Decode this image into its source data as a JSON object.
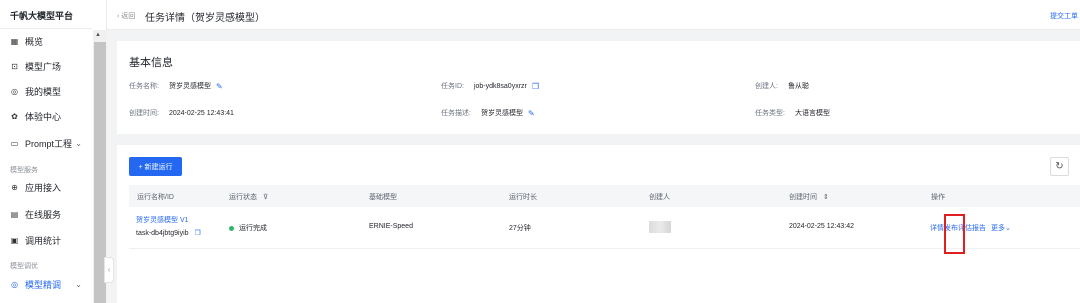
{
  "sidebar": {
    "brand": "千帆大模型平台",
    "items": [
      {
        "label": "概览",
        "icon": "grid-icon"
      },
      {
        "label": "模型广场",
        "icon": "scan-icon"
      },
      {
        "label": "我的模型",
        "icon": "settings-icon"
      },
      {
        "label": "体验中心",
        "icon": "gear-icon"
      },
      {
        "label": "Prompt工程",
        "icon": "folder-icon"
      }
    ],
    "group_service": "模型服务",
    "service_items": [
      {
        "label": "应用接入",
        "icon": "link-icon"
      },
      {
        "label": "在线服务",
        "icon": "server-icon"
      },
      {
        "label": "调用统计",
        "icon": "chart-icon"
      }
    ],
    "group_tuning": "模型调优",
    "tuning_items": [
      {
        "label": "模型精调",
        "icon": "tune-icon"
      }
    ]
  },
  "topbar": {
    "back": "返回",
    "title": "任务详情（贺岁灵感模型）",
    "submit": "提交工单"
  },
  "info": {
    "title": "基本信息",
    "task_name_label": "任务名称:",
    "task_name": "贺岁灵感模型",
    "task_id_label": "任务ID:",
    "task_id": "job-ydk8sa0yxrzr",
    "creator_label": "创建人:",
    "creator": "鲁从聪",
    "created_label": "创建时间:",
    "created": "2024-02-25 12:43:41",
    "desc_label": "任务描述:",
    "desc": "贺岁灵感模型",
    "type_label": "任务类型:",
    "type": "大语言模型"
  },
  "runs": {
    "new_button": "+ 新建运行",
    "headers": [
      "运行名称/ID",
      "运行状态",
      "基础模型",
      "运行时长",
      "创建人",
      "创建时间",
      "操作"
    ],
    "row": {
      "name": "贺岁灵感模型 V1",
      "id": "task-db4jbtg9iyib",
      "status": "运行完成",
      "status_color": "#31b56c",
      "base_model": "ERNIE-Speed",
      "duration": "27分钟",
      "created": "2024-02-25 12:43:42",
      "actions": {
        "detail": "详情",
        "publish": "发布",
        "report": "评估报告",
        "more": "更多"
      }
    }
  },
  "colors": {
    "accent": "#2468f2",
    "highlight": "#e02020"
  }
}
